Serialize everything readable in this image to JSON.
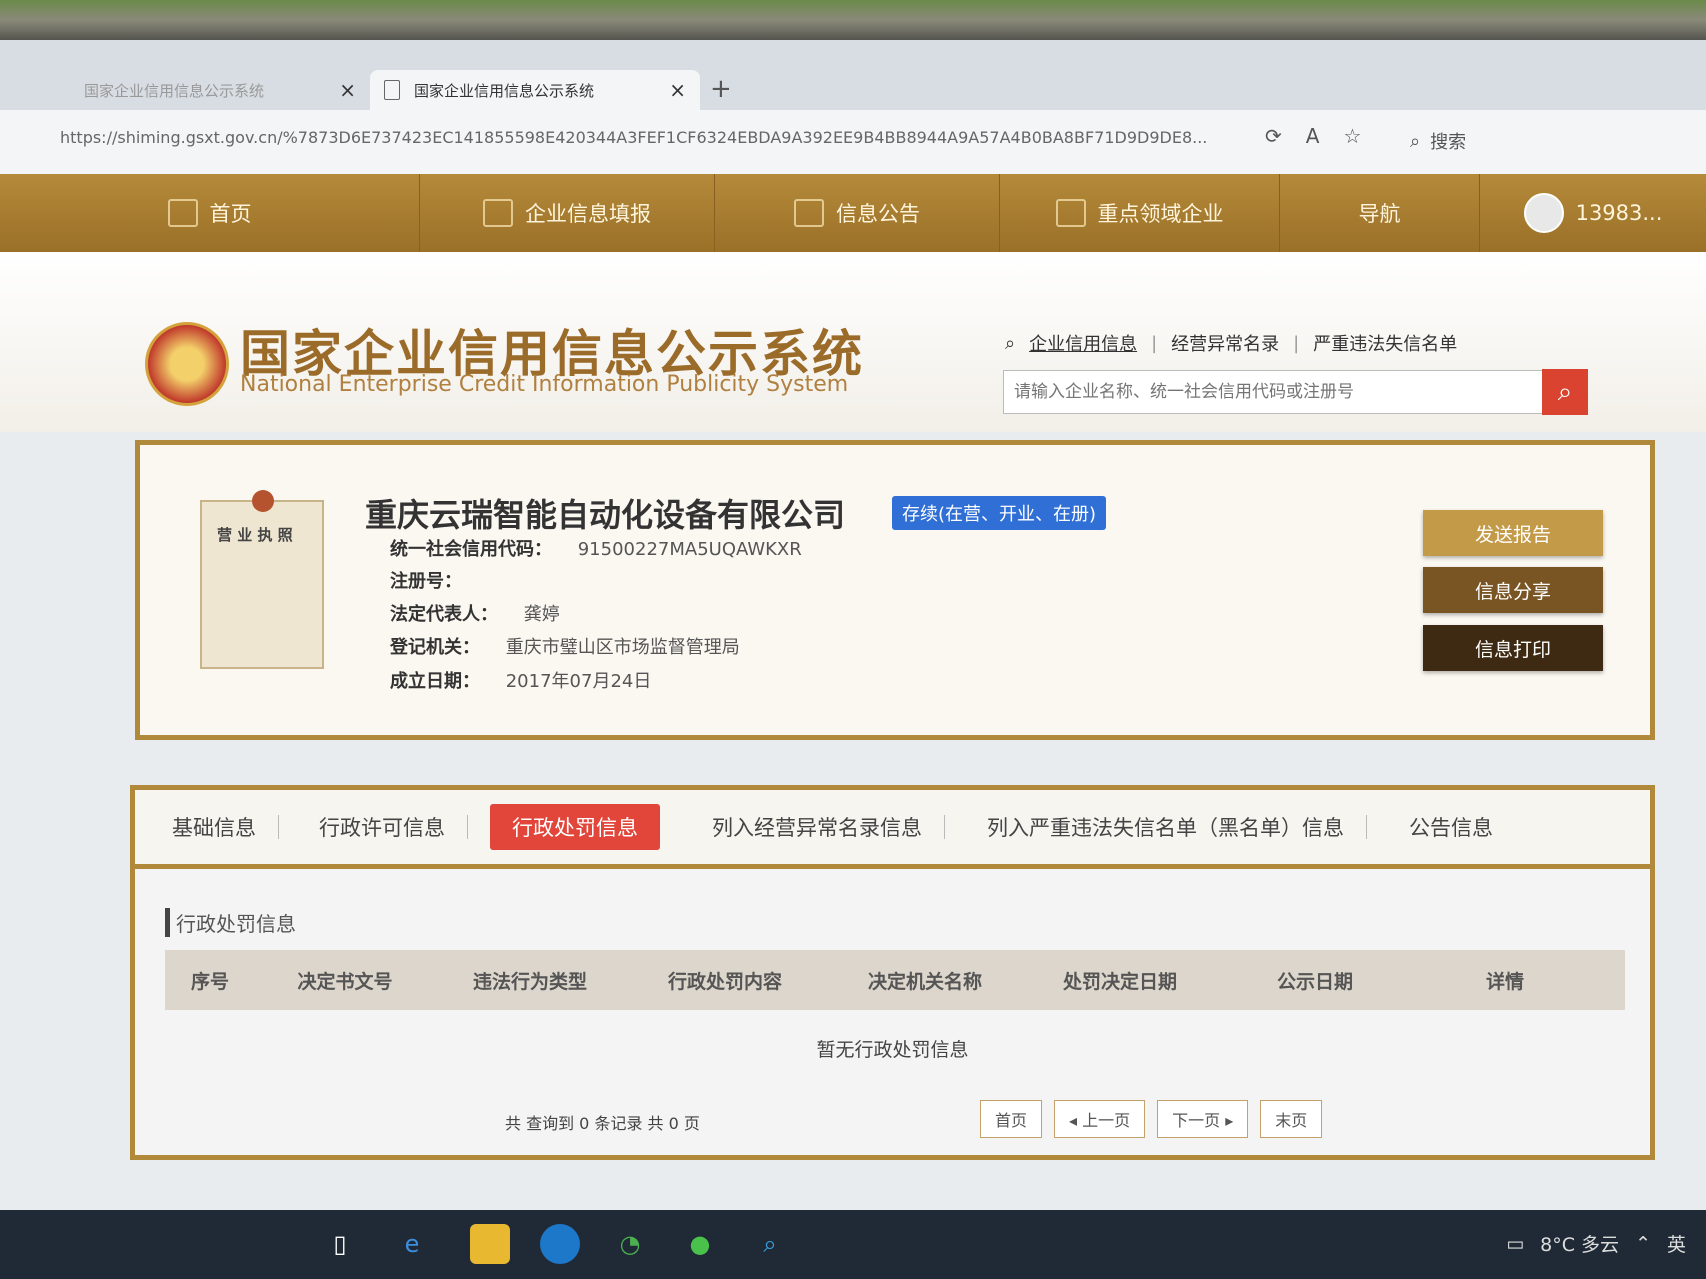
{
  "browser": {
    "tabs": [
      {
        "title": "国家企业信用信息公示系统"
      },
      {
        "title": "国家企业信用信息公示系统"
      }
    ],
    "new_tab": "+",
    "close": "×",
    "url": "https://shiming.gsxt.gov.cn/%7873D6E737423EC141855598E420344A3FEF1CF6324EBDA9A392EE9B4BB8944A9A57A4B0BA8BF71D9D9DE8...",
    "search_label": "搜索"
  },
  "site_nav": {
    "items": [
      "首页",
      "企业信息填报",
      "信息公告",
      "重点领域企业",
      "导航"
    ],
    "user": "13983..."
  },
  "brand": {
    "title": "国家企业信用信息公示系统",
    "subtitle": "National Enterprise Credit Information Publicity System"
  },
  "search": {
    "links": [
      "企业信用信息",
      "经营异常名录",
      "严重违法失信名单"
    ],
    "placeholder": "请输入企业名称、统一社会信用代码或注册号"
  },
  "company": {
    "license_label": "营 业 执 照",
    "name": "重庆云瑞智能自动化设备有限公司",
    "status": "存续(在营、开业、在册)",
    "fields": [
      {
        "key": "统一社会信用代码：",
        "value": "91500227MA5UQAWKXR"
      },
      {
        "key": "注册号：",
        "value": ""
      },
      {
        "key": "法定代表人：",
        "value": "龚婷"
      },
      {
        "key": "登记机关：",
        "value": "重庆市璧山区市场监督管理局"
      },
      {
        "key": "成立日期：",
        "value": "2017年07月24日"
      }
    ],
    "actions": [
      "发送报告",
      "信息分享",
      "信息打印"
    ]
  },
  "tabs": {
    "items": [
      "基础信息",
      "行政许可信息",
      "行政处罚信息",
      "列入经营异常名录信息",
      "列入严重违法失信名单（黑名单）信息",
      "公告信息"
    ],
    "active_index": 2
  },
  "section": {
    "title": "行政处罚信息",
    "columns": [
      "序号",
      "决定书文号",
      "违法行为类型",
      "行政处罚内容",
      "决定机关名称",
      "处罚决定日期",
      "公示日期",
      "详情"
    ],
    "empty": "暂无行政处罚信息",
    "summary": "共 查询到 0 条记录 共 0 页",
    "pager": [
      "首页",
      "◂ 上一页",
      "下一页 ▸",
      "末页"
    ]
  },
  "taskbar": {
    "weather": "8°C 多云",
    "ime": "英"
  },
  "colors": {
    "nav_gold": "#b58a3a",
    "border_gold": "#b08a3a",
    "active_tab": "#e2453a",
    "status_blue": "#2f6fd6",
    "search_red": "#d9432f"
  }
}
